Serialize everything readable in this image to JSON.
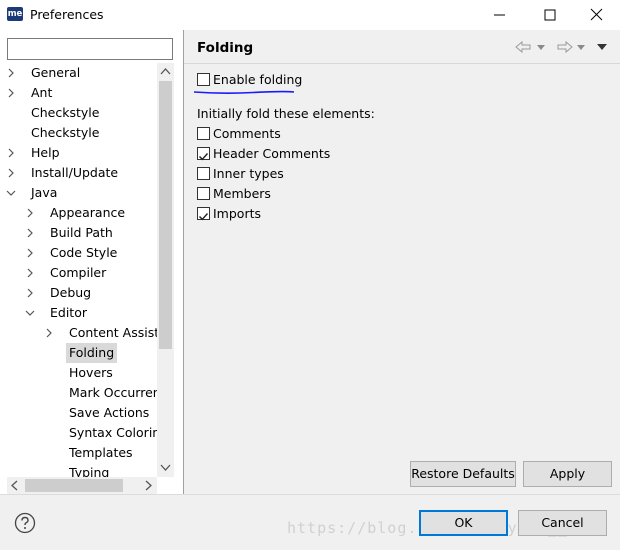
{
  "window": {
    "app_icon": "me",
    "title": "Preferences"
  },
  "filter": {
    "value": "",
    "placeholder": ""
  },
  "tree": {
    "items": [
      {
        "label": "General",
        "arrow": "right",
        "level": 0
      },
      {
        "label": "Ant",
        "arrow": "right",
        "level": 0
      },
      {
        "label": "Checkstyle",
        "arrow": "none",
        "level": 0
      },
      {
        "label": "Checkstyle",
        "arrow": "none",
        "level": 0
      },
      {
        "label": "Help",
        "arrow": "right",
        "level": 0
      },
      {
        "label": "Install/Update",
        "arrow": "right",
        "level": 0
      },
      {
        "label": "Java",
        "arrow": "down",
        "level": 0
      },
      {
        "label": "Appearance",
        "arrow": "right",
        "level": 1
      },
      {
        "label": "Build Path",
        "arrow": "right",
        "level": 1
      },
      {
        "label": "Code Style",
        "arrow": "right",
        "level": 1
      },
      {
        "label": "Compiler",
        "arrow": "right",
        "level": 1
      },
      {
        "label": "Debug",
        "arrow": "right",
        "level": 1
      },
      {
        "label": "Editor",
        "arrow": "down",
        "level": 1
      },
      {
        "label": "Content Assist",
        "arrow": "right",
        "level": 2
      },
      {
        "label": "Folding",
        "arrow": "none",
        "level": 2,
        "selected": true
      },
      {
        "label": "Hovers",
        "arrow": "none",
        "level": 2
      },
      {
        "label": "Mark Occurrences",
        "arrow": "none",
        "level": 2
      },
      {
        "label": "Save Actions",
        "arrow": "none",
        "level": 2
      },
      {
        "label": "Syntax Coloring",
        "arrow": "none",
        "level": 2
      },
      {
        "label": "Templates",
        "arrow": "none",
        "level": 2
      },
      {
        "label": "Typing",
        "arrow": "none",
        "level": 2
      }
    ]
  },
  "page": {
    "title": "Folding",
    "enable_folding": {
      "label": "Enable folding",
      "checked": false
    },
    "fold_heading": "Initially fold these elements:",
    "fold_options": [
      {
        "label": "Comments",
        "checked": false
      },
      {
        "label": "Header Comments",
        "checked": true
      },
      {
        "label": "Inner types",
        "checked": false
      },
      {
        "label": "Members",
        "checked": false
      },
      {
        "label": "Imports",
        "checked": true
      }
    ],
    "restore_defaults_label": "Restore Defaults",
    "apply_label": "Apply"
  },
  "footer": {
    "ok_label": "OK",
    "cancel_label": "Cancel",
    "watermark": "https://blog.csdn.net/ying__lin"
  },
  "colors": {
    "selection": "#d9d9d9",
    "annotation_underline": "#1a1aff",
    "primary_button_border": "#0078d7",
    "panel_background": "#f0f0f0"
  }
}
